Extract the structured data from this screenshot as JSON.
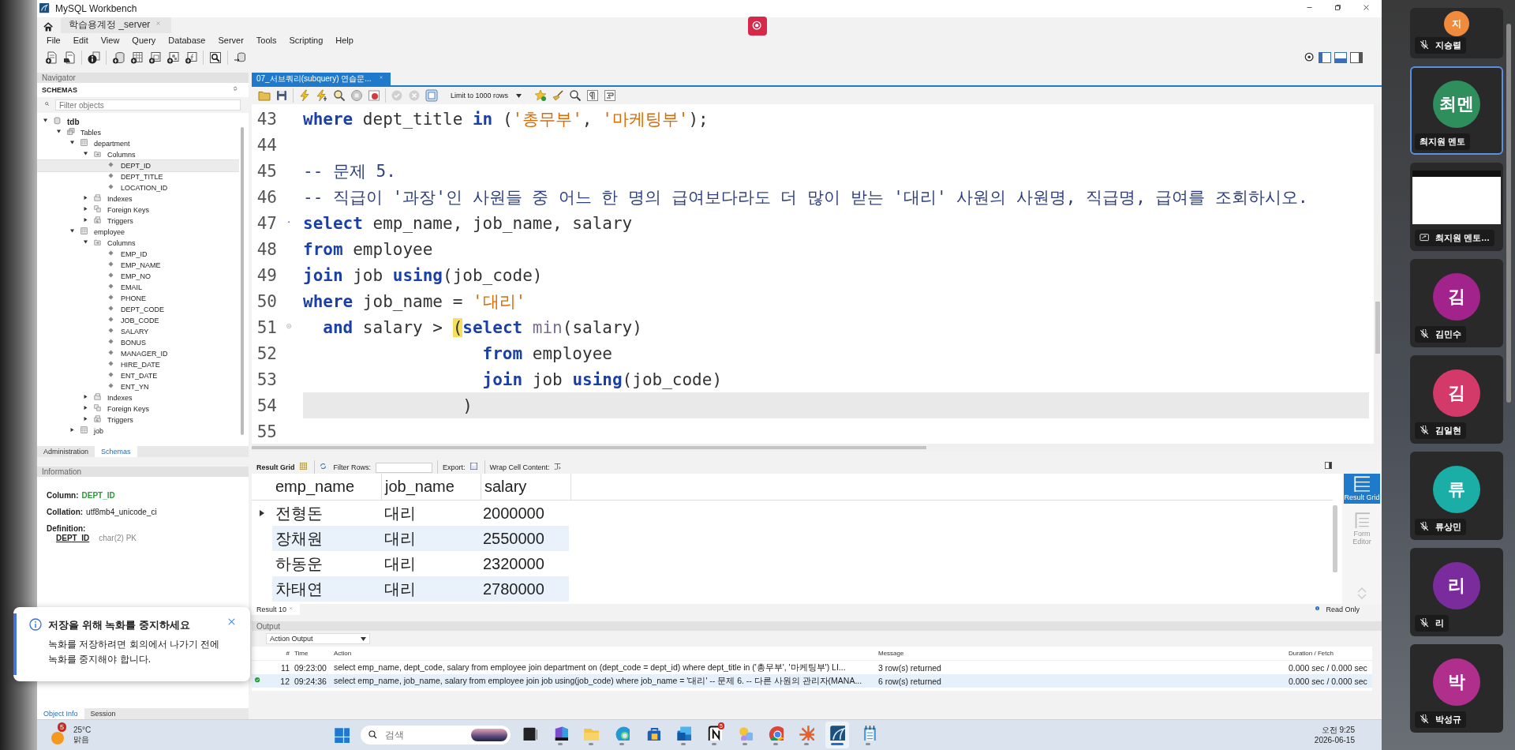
{
  "window": {
    "title": "MySQL Workbench"
  },
  "connection_tab": {
    "label": "학습용계정 _server",
    "selected": true
  },
  "menu": [
    "File",
    "Edit",
    "View",
    "Query",
    "Database",
    "Server",
    "Tools",
    "Scripting",
    "Help"
  ],
  "navigator": {
    "title": "Navigator",
    "schemas_label": "SCHEMAS",
    "filter_placeholder": "Filter objects",
    "tree": [
      {
        "label": "tdb",
        "kind": "schema",
        "expanded": true,
        "selected": false,
        "children": [
          {
            "label": "Tables",
            "kind": "tables",
            "expanded": true,
            "selected": false,
            "children": [
              {
                "label": "department",
                "kind": "table",
                "expanded": true,
                "selected": false,
                "children": [
                  {
                    "label": "Columns",
                    "kind": "columns",
                    "expanded": true,
                    "selected": false,
                    "children": [
                      {
                        "label": "DEPT_ID",
                        "kind": "column",
                        "selected": true
                      },
                      {
                        "label": "DEPT_TITLE",
                        "kind": "column",
                        "selected": false
                      },
                      {
                        "label": "LOCATION_ID",
                        "kind": "column",
                        "selected": false
                      }
                    ]
                  },
                  {
                    "label": "Indexes",
                    "kind": "indexes",
                    "expanded": false,
                    "selected": false
                  },
                  {
                    "label": "Foreign Keys",
                    "kind": "foreign_keys",
                    "expanded": false,
                    "selected": false
                  },
                  {
                    "label": "Triggers",
                    "kind": "triggers",
                    "expanded": false,
                    "selected": false
                  }
                ]
              },
              {
                "label": "employee",
                "kind": "table",
                "expanded": true,
                "selected": false,
                "children": [
                  {
                    "label": "Columns",
                    "kind": "columns",
                    "expanded": true,
                    "selected": false,
                    "children": [
                      {
                        "label": "EMP_ID",
                        "kind": "column",
                        "selected": false
                      },
                      {
                        "label": "EMP_NAME",
                        "kind": "column",
                        "selected": false
                      },
                      {
                        "label": "EMP_NO",
                        "kind": "column",
                        "selected": false
                      },
                      {
                        "label": "EMAIL",
                        "kind": "column",
                        "selected": false
                      },
                      {
                        "label": "PHONE",
                        "kind": "column",
                        "selected": false
                      },
                      {
                        "label": "DEPT_CODE",
                        "kind": "column",
                        "selected": false
                      },
                      {
                        "label": "JOB_CODE",
                        "kind": "column",
                        "selected": false
                      },
                      {
                        "label": "SALARY",
                        "kind": "column",
                        "selected": false
                      },
                      {
                        "label": "BONUS",
                        "kind": "column",
                        "selected": false
                      },
                      {
                        "label": "MANAGER_ID",
                        "kind": "column",
                        "selected": false
                      },
                      {
                        "label": "HIRE_DATE",
                        "kind": "column",
                        "selected": false
                      },
                      {
                        "label": "ENT_DATE",
                        "kind": "column",
                        "selected": false
                      },
                      {
                        "label": "ENT_YN",
                        "kind": "column",
                        "selected": false
                      }
                    ]
                  },
                  {
                    "label": "Indexes",
                    "kind": "indexes",
                    "expanded": false,
                    "selected": false
                  },
                  {
                    "label": "Foreign Keys",
                    "kind": "foreign_keys",
                    "expanded": false,
                    "selected": false
                  },
                  {
                    "label": "Triggers",
                    "kind": "triggers",
                    "expanded": false,
                    "selected": false
                  }
                ]
              },
              {
                "label": "job",
                "kind": "table",
                "expanded": false,
                "selected": false
              }
            ]
          }
        ]
      }
    ],
    "tabs": [
      {
        "label": "Administration",
        "selected": false
      },
      {
        "label": "Schemas",
        "selected": true
      }
    ]
  },
  "information": {
    "title": "Information",
    "column_label": "Column:",
    "column_value": "DEPT_ID",
    "collation_label": "Collation:",
    "collation_value": "utf8mb4_unicode_ci",
    "definition_label": "Definition:",
    "definition_name": "DEPT_ID",
    "definition_type": "char(2) PK",
    "tabs": [
      {
        "label": "Object Info",
        "selected": true
      },
      {
        "label": "Session",
        "selected": false
      }
    ]
  },
  "editor": {
    "tabs": [
      {
        "label": "07_서브쿼리(subquery) 연습문...",
        "selected": true
      }
    ],
    "limit": "Limit to 1000 rows",
    "lines": [
      {
        "number": "43",
        "current": false,
        "tokens": [
          {
            "text": "where",
            "kind": "keyword"
          },
          {
            "text": " dept_title ",
            "kind": "plain"
          },
          {
            "text": "in",
            "kind": "keyword"
          },
          {
            "text": " (",
            "kind": "plain"
          },
          {
            "text": "'총무부'",
            "kind": "string"
          },
          {
            "text": ", ",
            "kind": "plain"
          },
          {
            "text": "'마케팅부'",
            "kind": "string"
          },
          {
            "text": ");",
            "kind": "plain"
          }
        ]
      },
      {
        "number": "44",
        "current": false
      },
      {
        "number": "45",
        "current": false,
        "tokens": [
          {
            "text": "-- 문제 5.",
            "kind": "comment"
          }
        ]
      },
      {
        "number": "46",
        "current": false,
        "tokens": [
          {
            "text": "-- 직급이 '과장'인 사원들 중 어느 한 명의 급여보다라도 더 많이 받는 '대리' 사원의 사원명, 직급명, 급여를 조회하시오.",
            "kind": "comment"
          }
        ]
      },
      {
        "number": "47",
        "current": false,
        "statement_start": true,
        "foldable": false,
        "tokens": [
          {
            "text": "select",
            "kind": "keyword"
          },
          {
            "text": " emp_name, job_name, salary",
            "kind": "plain"
          }
        ]
      },
      {
        "number": "48",
        "current": false,
        "tokens": [
          {
            "text": "from",
            "kind": "keyword"
          },
          {
            "text": " employee",
            "kind": "plain"
          }
        ]
      },
      {
        "number": "49",
        "current": false,
        "tokens": [
          {
            "text": "join",
            "kind": "keyword"
          },
          {
            "text": " job ",
            "kind": "plain"
          },
          {
            "text": "using",
            "kind": "keyword"
          },
          {
            "text": "(job_code)",
            "kind": "plain"
          }
        ]
      },
      {
        "number": "50",
        "current": false,
        "tokens": [
          {
            "text": "where",
            "kind": "keyword"
          },
          {
            "text": " job_name = ",
            "kind": "plain"
          },
          {
            "text": "'대리'",
            "kind": "string"
          }
        ]
      },
      {
        "number": "51",
        "current": false,
        "statement_start": false,
        "foldable": true,
        "tokens": [
          {
            "text": "  and",
            "kind": "keyword"
          },
          {
            "text": " salary > ",
            "kind": "plain"
          },
          {
            "text": "(",
            "kind": "matched_bracket"
          },
          {
            "text": "select",
            "kind": "keyword"
          },
          {
            "text": " min",
            "kind": "function"
          },
          {
            "text": "(salary)",
            "kind": "plain"
          }
        ]
      },
      {
        "number": "52",
        "current": false,
        "tokens": [
          {
            "text": "                  from",
            "kind": "keyword"
          },
          {
            "text": " employee",
            "kind": "plain"
          }
        ]
      },
      {
        "number": "53",
        "current": false,
        "tokens": [
          {
            "text": "                  join",
            "kind": "keyword"
          },
          {
            "text": " job ",
            "kind": "plain"
          },
          {
            "text": "using",
            "kind": "keyword"
          },
          {
            "text": "(job_code)",
            "kind": "plain"
          }
        ]
      },
      {
        "number": "54",
        "current": true,
        "tokens": [
          {
            "text": "                )",
            "kind": "plain"
          }
        ]
      },
      {
        "number": "55",
        "current": false
      }
    ]
  },
  "result": {
    "toolbar": {
      "grid_label": "Result Grid",
      "filter_label": "Filter Rows:",
      "export_label": "Export:",
      "wrap_label": "Wrap Cell Content:"
    },
    "columns": [
      "emp_name",
      "job_name",
      "salary"
    ],
    "rows": [
      {
        "current": true,
        "cells": [
          "전형돈",
          "대리",
          "2000000"
        ]
      },
      {
        "current": false,
        "cells": [
          "장채원",
          "대리",
          "2550000"
        ]
      },
      {
        "current": false,
        "cells": [
          "하동운",
          "대리",
          "2320000"
        ]
      },
      {
        "current": false,
        "cells": [
          "차태연",
          "대리",
          "2780000"
        ]
      }
    ],
    "side_buttons": [
      {
        "label": "Result Grid",
        "kind": "grid",
        "selected": true
      },
      {
        "label": "Form Editor",
        "kind": "form",
        "selected": false
      }
    ],
    "tab": "Result 10",
    "read_only": "Read Only"
  },
  "output": {
    "title": "Output",
    "mode": "Action Output",
    "columns": [
      "#",
      "Time",
      "Action",
      "Message",
      "Duration / Fetch"
    ],
    "rows": [
      {
        "number": "11",
        "time": "09:23:00",
        "action": "select emp_name, dept_code, salary  from employee   join department on (dept_code = dept_id)  where dept_title in ('총무부', '마케팅부') LI...",
        "message": "3 row(s) returned",
        "duration": "0.000 sec / 0.000 sec",
        "check": false,
        "selected": false
      },
      {
        "number": "12",
        "time": "09:24:36",
        "check": true,
        "action": "select emp_name, job_name, salary from employee join job using(job_code) where job_name = '대리'  -- 문제 6.  -- 다른 사원의 관리자(MANA...",
        "message": "6 row(s) returned",
        "duration": "0.000 sec / 0.000 sec",
        "selected": true
      }
    ]
  },
  "notification": {
    "title": "저장을 위해 녹화를 중지하세요",
    "message": "녹화를 저장하려면 회의에서 나가기 전에 녹화를 중지해야 합니다."
  },
  "participants": [
    {
      "kind": "avatar",
      "initials": "지",
      "name": "지승렬",
      "muted": true,
      "selected": false,
      "color": "#f08a3c"
    },
    {
      "kind": "avatar",
      "initials": "최멘",
      "name": "최지원 멘토",
      "muted": false,
      "selected": true,
      "color": "#2e8f5c"
    },
    {
      "kind": "screen",
      "name": "최지원 멘토…",
      "selected": false
    },
    {
      "kind": "avatar",
      "initials": "김",
      "name": "김민수",
      "muted": true,
      "selected": false,
      "color": "#a3238c"
    },
    {
      "kind": "avatar",
      "initials": "김",
      "name": "김일현",
      "muted": true,
      "selected": false,
      "color": "#d33a6a"
    },
    {
      "kind": "avatar",
      "initials": "류",
      "name": "류상민",
      "muted": true,
      "selected": false,
      "color": "#1aaea6"
    },
    {
      "kind": "avatar",
      "initials": "리",
      "name": "리",
      "muted": true,
      "selected": false,
      "color": "#7b2c9c"
    },
    {
      "kind": "avatar",
      "initials": "박",
      "name": "박성규",
      "muted": true,
      "selected": false,
      "color": "#b02f8c"
    }
  ],
  "taskbar": {
    "weather": {
      "badge": "5",
      "temperature": "25°C",
      "condition": "맑음"
    },
    "search_placeholder": "검색",
    "apps": [
      {
        "kind": "task_view",
        "running": false,
        "active": false
      },
      {
        "kind": "office",
        "running": true,
        "active": false
      },
      {
        "kind": "folder",
        "running": true,
        "active": false
      },
      {
        "kind": "browser",
        "running": true,
        "active": false
      },
      {
        "kind": "store",
        "running": false,
        "active": false
      },
      {
        "kind": "mail",
        "running": true,
        "active": false
      },
      {
        "kind": "notes",
        "running": true,
        "active": false,
        "badge": "5"
      },
      {
        "kind": "circles",
        "running": true,
        "active": false
      },
      {
        "kind": "chrome",
        "running": true,
        "active": false
      },
      {
        "kind": "spark",
        "running": true,
        "active": false
      },
      {
        "kind": "workbench",
        "running": true,
        "active": true
      },
      {
        "kind": "notepad",
        "running": true,
        "active": false
      }
    ],
    "time": "오전 9:25",
    "date": "2026-06-15"
  }
}
